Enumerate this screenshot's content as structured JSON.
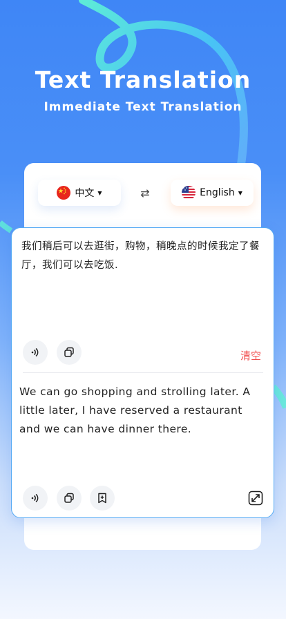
{
  "hero": {
    "title": "Text Translation",
    "subtitle": "Immediate Text Translation"
  },
  "languages": {
    "source": {
      "label": "中文",
      "flag": "china-flag-icon"
    },
    "target": {
      "label": "English",
      "flag": "usa-flag-icon"
    },
    "swap_icon": "swap-icon"
  },
  "source_panel": {
    "text": "我们稍后可以去逛街，购物，稍晚点的时候我定了餐厅，我们可以去吃饭.",
    "clear_label": "清空"
  },
  "target_panel": {
    "text": "We can go shopping and strolling later. A little later, I have reserved a restaurant and we can have dinner there."
  },
  "colors": {
    "accent": "#3f86f6",
    "clear": "#f04a4a",
    "card_border": "#55aaf4"
  }
}
